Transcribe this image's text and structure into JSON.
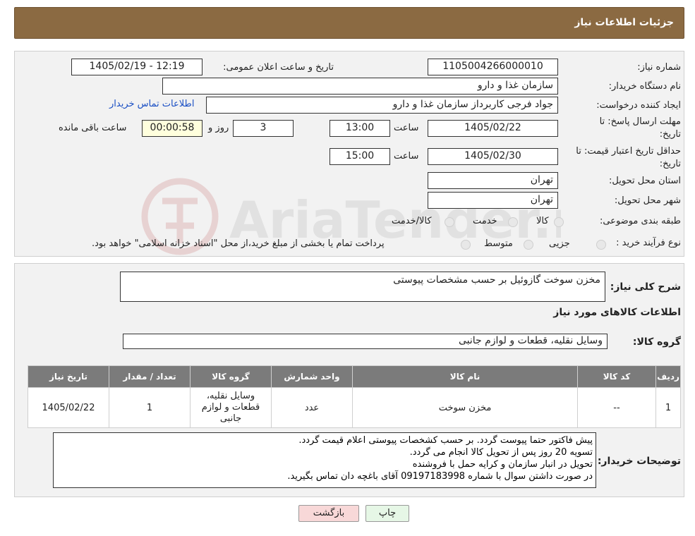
{
  "header": {
    "title": "جزئیات اطلاعات نیاز"
  },
  "form": {
    "need_number_label": "شماره نیاز:",
    "need_number": "1105004266000010",
    "announce_label": "تاریخ و ساعت اعلان عمومی:",
    "announce_value": "1405/02/19 - 12:19",
    "buyer_org_label": "نام دستگاه خریدار:",
    "buyer_org": "سازمان غذا و دارو",
    "requester_label": "ایجاد کننده درخواست:",
    "requester": "جواد فرجی کاربرداز سازمان غذا و دارو",
    "contact_link": "اطلاعات تماس خریدار",
    "deadline_label_1": "مهلت ارسال پاسخ: تا",
    "deadline_label_2": "تاریخ:",
    "deadline_date": "1405/02/22",
    "time_label": "ساعت",
    "deadline_time": "13:00",
    "days_value": "3",
    "days_label": "روز و",
    "remaining_time": "00:00:58",
    "remaining_label": "ساعت باقی مانده",
    "validity_label_1": "حداقل تاریخ اعتبار قیمت: تا",
    "validity_label_2": "تاریخ:",
    "validity_date": "1405/02/30",
    "validity_time": "15:00",
    "province_label": "استان محل تحویل:",
    "province": "تهران",
    "city_label": "شهر محل تحویل:",
    "city": "تهران",
    "category_label": "طبقه بندی موضوعی:",
    "category_options": [
      "کالا",
      "خدمت",
      "کالا/خدمت"
    ],
    "process_label": "نوع فرآیند خرید :",
    "process_options": [
      "جزیی",
      "متوسط"
    ],
    "payment_note": "پرداخت تمام یا بخشی از مبلغ خرید،از محل \"اسناد خزانه اسلامی\" خواهد بود."
  },
  "summary": {
    "desc_label": "شرح کلی نیاز:",
    "desc_value": "مخزن سوخت گازوئیل بر حسب مشخصات پیوستی",
    "goods_info_title": "اطلاعات کالاهای مورد نیاز",
    "goods_group_label": "گروه کالا:",
    "goods_group": "وسایل نقلیه، قطعات و لوازم جانبی"
  },
  "table": {
    "headers": [
      "ردیف",
      "کد کالا",
      "نام کالا",
      "واحد شمارش",
      "گروه کالا",
      "تعداد / مقدار",
      "تاریخ نیاز"
    ],
    "rows": [
      [
        "1",
        "--",
        "مخزن سوخت",
        "عدد",
        "وسایل نقلیه، قطعات و لوازم جانبی",
        "1",
        "1405/02/22"
      ]
    ]
  },
  "notes": {
    "label": "توضیحات خریدار:",
    "text": "پیش فاکتور حتما پیوست گردد. بر حسب کشخصات پیوستی اعلام قیمت گردد.\nتسویه 20 روز پس از تحویل کالا انجام می گردد.\nتحویل در انبار سازمان و کرایه حمل با فروشنده\nدر صورت داشتن سوال با شماره 09197183998 آقای باغچه دان تماس بگیرید."
  },
  "buttons": {
    "print": "چاپ",
    "back": "بازگشت"
  },
  "watermark_text": "AriaTender.neT",
  "colors": {
    "header_bg": "#8b6a42",
    "table_header_bg": "#7b7b7b",
    "back_btn_bg": "#f8d8d8",
    "print_btn_bg": "#e6f7e6",
    "remaining_bg": "#ffffdd"
  }
}
